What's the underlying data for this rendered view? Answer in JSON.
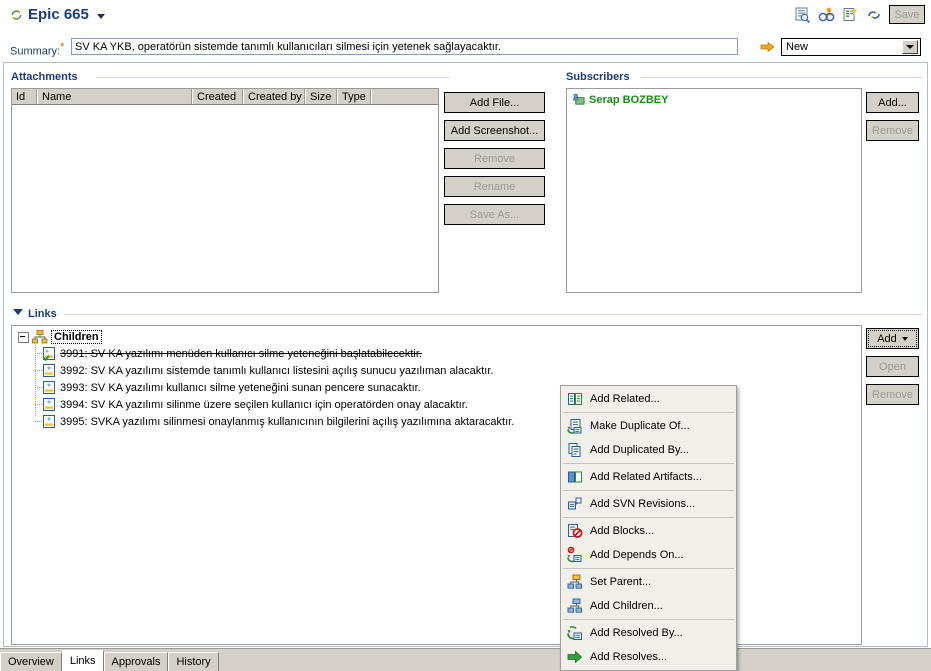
{
  "header": {
    "title": "Epic 665",
    "refresh_icon": "refresh-icon",
    "caret_icon": "chevron-down-icon",
    "toolbar": {
      "icons": [
        {
          "name": "search-artifact-icon",
          "label": "Search Artifact"
        },
        {
          "name": "assign-user-icon",
          "label": "Assign User"
        },
        {
          "name": "new-artifact-icon",
          "label": "New Artifact"
        },
        {
          "name": "refresh-links-icon",
          "label": "Refresh"
        }
      ],
      "save_label": "Save"
    }
  },
  "summary": {
    "label": "Summary:",
    "required_marker": "*",
    "value": "SV KA YKB, operatörün sistemde tanımlı kullanıcıları silmesi için yetenek sağlayacaktır.",
    "placeholder": "",
    "arrow_icon": "arrow-right-icon"
  },
  "state": {
    "value": "New",
    "options": [
      "New"
    ]
  },
  "attachments": {
    "title": "Attachments",
    "columns": [
      "Id",
      "Name",
      "Created",
      "Created by",
      "Size",
      "Type",
      ""
    ],
    "rows": [],
    "buttons": [
      {
        "label": "Add File...",
        "enabled": true
      },
      {
        "label": "Add Screenshot...",
        "enabled": true
      },
      {
        "label": "Remove",
        "enabled": false
      },
      {
        "label": "Rename",
        "enabled": false
      },
      {
        "label": "Save As...",
        "enabled": false
      }
    ]
  },
  "subscribers": {
    "title": "Subscribers",
    "items": [
      {
        "name": "Serap BOZBEY",
        "icon": "user-subscriber-icon",
        "color": "#1a8a1a"
      }
    ],
    "buttons": [
      {
        "label": "Add...",
        "enabled": true
      },
      {
        "label": "Remove",
        "enabled": false
      }
    ]
  },
  "links": {
    "title": "Links",
    "tree": {
      "root_label": "Children",
      "root_icon": "hierarchy-children-icon",
      "children": [
        {
          "text": "3991: SV KA yazılımı menüden kullanıcı silme yeteneğini başlatabilecektir.",
          "icon": "task-complete-icon",
          "completed": true
        },
        {
          "text": "3992: SV KA yazılımı sistemde tanımlı kullanıcı listesini açılış sunucu yazılıman alacaktır.",
          "icon": "task-icon",
          "completed": false
        },
        {
          "text": "3993: SV KA yazılımı kullanıcı silme yeteneğini sunan pencere sunacaktır.",
          "icon": "task-icon",
          "completed": false
        },
        {
          "text": "3994: SV KA yazılımı silinme üzere seçilen kullanıcı için operatörden onay alacaktır.",
          "icon": "task-icon",
          "completed": false
        },
        {
          "text": "3995: SVKA yazılımı silinmesi onaylanmış kullanıcının bilgilerini açılış yazılımına aktaracaktır.",
          "icon": "task-icon",
          "completed": false
        }
      ]
    },
    "buttons": [
      {
        "label": "Add",
        "enabled": true,
        "has_dropdown": true
      },
      {
        "label": "Open",
        "enabled": false
      },
      {
        "label": "Remove",
        "enabled": false
      }
    ]
  },
  "context_menu": {
    "groups": [
      [
        {
          "label": "Add Related...",
          "icon": "add-related-icon"
        }
      ],
      [
        {
          "label": "Make Duplicate Of...",
          "icon": "make-duplicate-of-icon"
        },
        {
          "label": "Add Duplicated By...",
          "icon": "add-duplicated-by-icon"
        }
      ],
      [
        {
          "label": "Add Related Artifacts...",
          "icon": "add-related-artifacts-icon"
        }
      ],
      [
        {
          "label": "Add SVN Revisions...",
          "icon": "add-svn-revisions-icon"
        }
      ],
      [
        {
          "label": "Add Blocks...",
          "icon": "add-blocks-icon"
        },
        {
          "label": "Add Depends On...",
          "icon": "add-depends-on-icon"
        }
      ],
      [
        {
          "label": "Set Parent...",
          "icon": "set-parent-icon"
        },
        {
          "label": "Add Children...",
          "icon": "add-children-icon"
        }
      ],
      [
        {
          "label": "Add Resolved By...",
          "icon": "add-resolved-by-icon"
        },
        {
          "label": "Add Resolves...",
          "icon": "add-resolves-icon"
        }
      ]
    ]
  },
  "tabs": [
    {
      "label": "Overview",
      "active": false
    },
    {
      "label": "Links",
      "active": true
    },
    {
      "label": "Approvals",
      "active": false
    },
    {
      "label": "History",
      "active": false
    }
  ]
}
